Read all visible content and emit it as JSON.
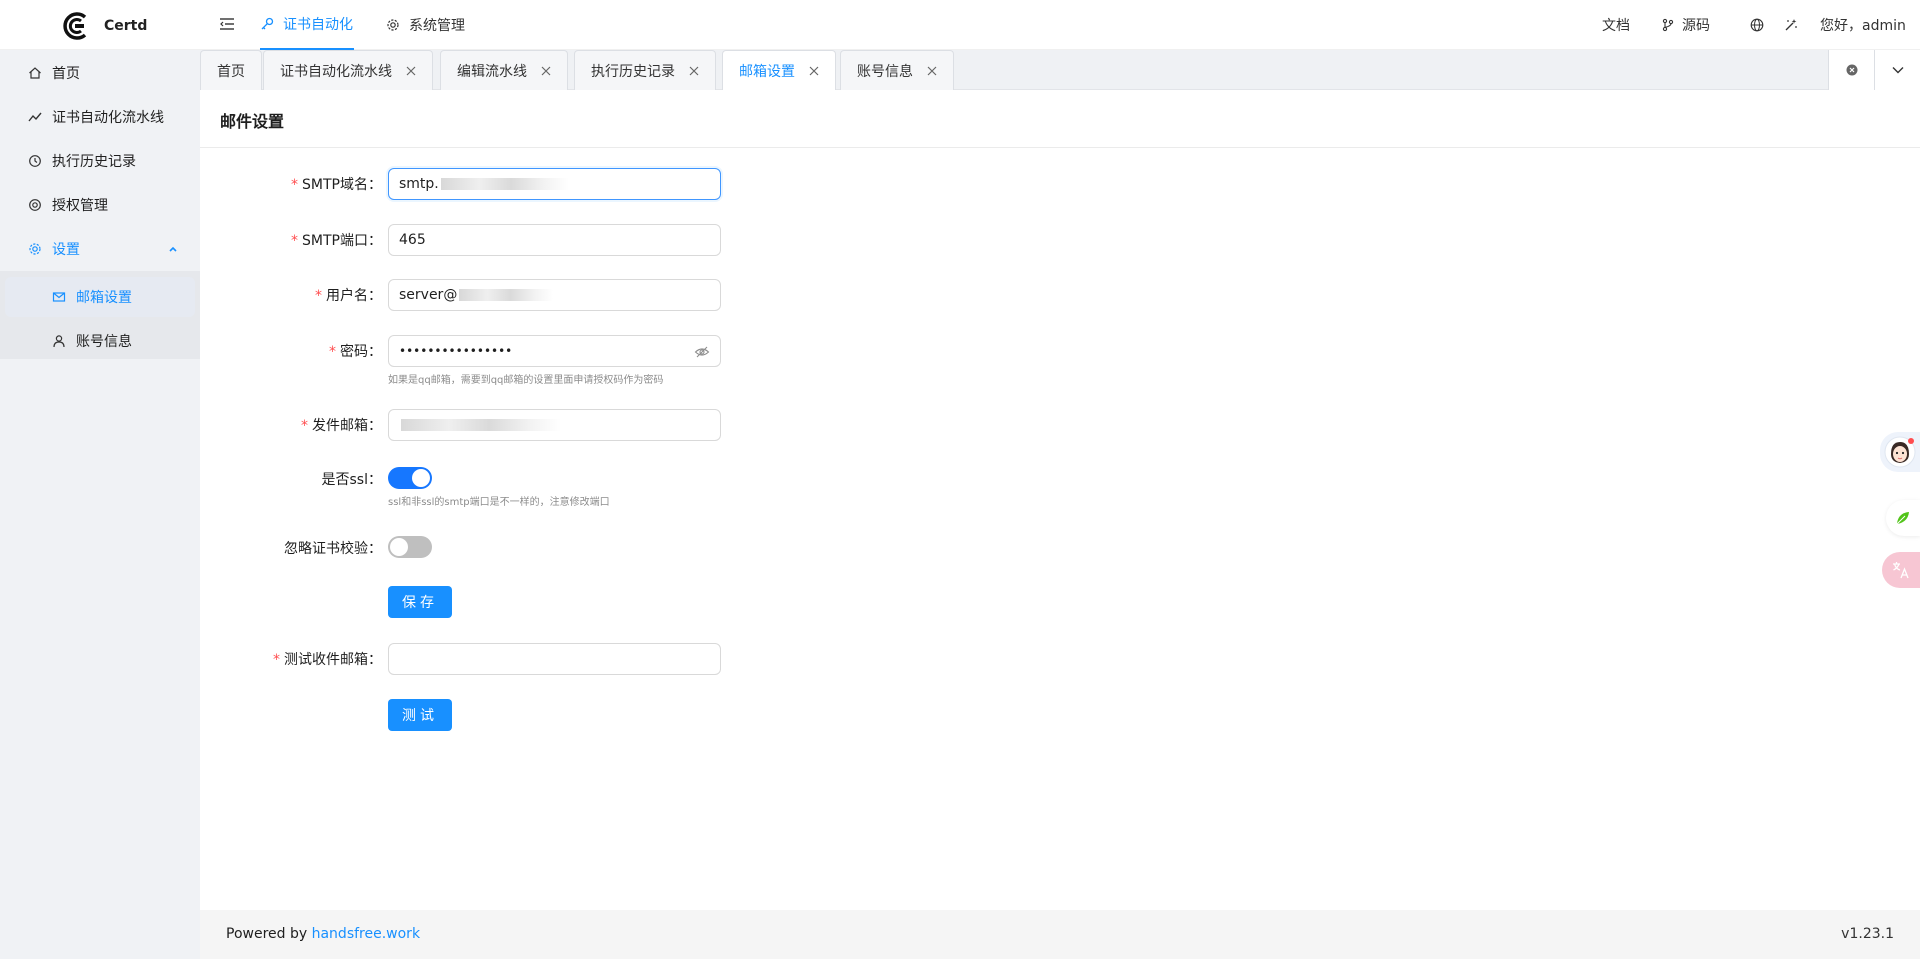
{
  "app": {
    "name": "Certd"
  },
  "topnav": {
    "items": [
      {
        "label": "证书自动化",
        "active": true
      },
      {
        "label": "系统管理",
        "active": false
      }
    ],
    "right": {
      "docs": "文档",
      "source": "源码",
      "greeting": "您好，admin"
    }
  },
  "sidebar": {
    "items": [
      {
        "label": "首页"
      },
      {
        "label": "证书自动化流水线"
      },
      {
        "label": "执行历史记录"
      },
      {
        "label": "授权管理"
      },
      {
        "label": "设置"
      }
    ],
    "settings_children": [
      {
        "label": "邮箱设置"
      },
      {
        "label": "账号信息"
      }
    ]
  },
  "tabs": [
    {
      "label": "首页",
      "closable": false
    },
    {
      "label": "证书自动化流水线",
      "closable": true
    },
    {
      "label": "编辑流水线",
      "closable": true
    },
    {
      "label": "执行历史记录",
      "closable": true
    },
    {
      "label": "邮箱设置",
      "closable": true,
      "active": true
    },
    {
      "label": "账号信息",
      "closable": true
    }
  ],
  "page": {
    "title": "邮件设置",
    "form": {
      "smtp_host": {
        "label": "SMTP域名：",
        "value": "smtp."
      },
      "smtp_port": {
        "label": "SMTP端口：",
        "value": "465"
      },
      "username": {
        "label": "用户名：",
        "value": "server@"
      },
      "password": {
        "label": "密码：",
        "value": "••••••••••••••••",
        "help": "如果是qq邮箱，需要到qq邮箱的设置里面申请授权码作为密码"
      },
      "sender": {
        "label": "发件邮箱：",
        "value": ""
      },
      "ssl": {
        "label": "是否ssl：",
        "enabled": true,
        "help": "ssl和非ssl的smtp端口是不一样的，注意修改端口"
      },
      "ignore_cert": {
        "label": "忽略证书校验：",
        "enabled": false
      },
      "save_label": "保存",
      "test_email": {
        "label": "测试收件邮箱：",
        "value": ""
      },
      "test_label": "测试"
    }
  },
  "footer": {
    "powered_by": "Powered by",
    "link": "handsfree.work",
    "version": "v1.23.1"
  },
  "colors": {
    "primary": "#1890ff",
    "danger": "#ff4d4f",
    "sidebar_bg": "#f0f2f5"
  }
}
